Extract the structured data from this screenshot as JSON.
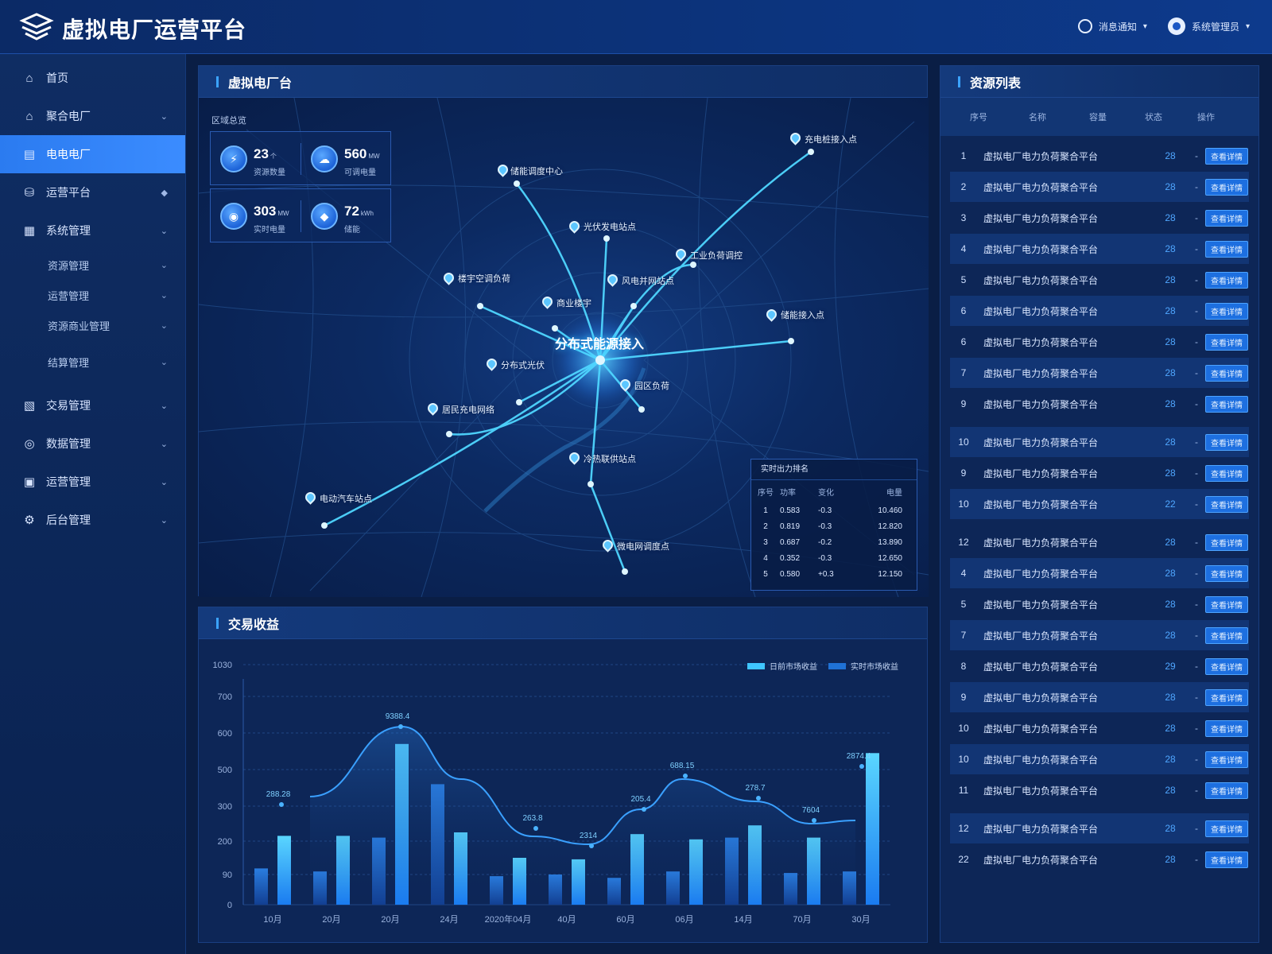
{
  "app": {
    "title": "虚拟电厂运营平台"
  },
  "header": {
    "notice_label": "消息通知",
    "user_label": "系统管理员"
  },
  "sidebar": {
    "items": [
      {
        "label": "首页",
        "icon": "home-icon"
      },
      {
        "label": "聚合电厂",
        "icon": "plant-icon"
      },
      {
        "label": "电电电厂",
        "icon": "document-icon"
      },
      {
        "label": "运营平台",
        "icon": "platform-icon"
      },
      {
        "label": "系统管理",
        "icon": "grid-icon"
      }
    ],
    "subitems": [
      {
        "label": "资源管理"
      },
      {
        "label": "运营管理"
      },
      {
        "label": "资源商业管理"
      },
      {
        "label": "结算管理"
      }
    ],
    "items2": [
      {
        "label": "交易管理",
        "icon": "chart-icon"
      },
      {
        "label": "数据管理",
        "icon": "data-icon"
      },
      {
        "label": "运营管理",
        "icon": "monitor-icon"
      },
      {
        "label": "后台管理",
        "icon": "settings-icon"
      }
    ]
  },
  "map_panel": {
    "title": "虚拟电厂台",
    "subtitle": "区域总览",
    "center_label": "分布式能源接入",
    "stats": [
      {
        "value": "23",
        "unit": "个",
        "label": "资源数量"
      },
      {
        "value": "560",
        "unit": "MW",
        "label": "可调电量"
      },
      {
        "value": "303",
        "unit": "MW",
        "label": "实时电量"
      },
      {
        "value": "72",
        "unit": "kWh",
        "label": "储能"
      }
    ],
    "nodes": [
      {
        "label": "储能调度中心"
      },
      {
        "label": "光伏发电站点"
      },
      {
        "label": "充电桩接入点"
      },
      {
        "label": "工业负荷调控"
      },
      {
        "label": "楼宇空调负荷"
      },
      {
        "label": "风电并网站点"
      },
      {
        "label": "商业楼宇"
      },
      {
        "label": "储能接入点"
      },
      {
        "label": "分布式光伏"
      },
      {
        "label": "园区负荷"
      },
      {
        "label": "居民充电网络"
      },
      {
        "label": "电动汽车站点"
      },
      {
        "label": "冷热联供站点"
      },
      {
        "label": "微电网调度点"
      }
    ],
    "legend": {
      "title": "实时出力排名",
      "headers": [
        "序号",
        "功率",
        "变化",
        "电量"
      ],
      "rows": [
        [
          "1",
          "0.583",
          "-0.3",
          "10.460"
        ],
        [
          "2",
          "0.819",
          "-0.3",
          "12.820"
        ],
        [
          "3",
          "0.687",
          "-0.2",
          "13.890"
        ],
        [
          "4",
          "0.352",
          "-0.3",
          "12.650"
        ],
        [
          "5",
          "0.580",
          "+0.3",
          "12.150"
        ]
      ]
    }
  },
  "chart_data": {
    "type": "bar",
    "title": "交易收益",
    "legend": [
      "日前市场收益",
      "实时市场收益"
    ],
    "y_ticks": [
      "0",
      "90",
      "200",
      "300",
      "500",
      "600",
      "700",
      "1030"
    ],
    "x_labels": [
      "10月",
      "20月",
      "20月",
      "24月",
      "2020年04月",
      "40月",
      "60月",
      "06月",
      "14月",
      "70月",
      "30月"
    ],
    "series": [
      {
        "name": "日前市场收益",
        "values": [
          110,
          100,
          210,
          420,
          85,
          90,
          80,
          100,
          210,
          95,
          100
        ]
      },
      {
        "name": "实时市场收益",
        "values": [
          215,
          215,
          570,
          225,
          145,
          140,
          220,
          205,
          245,
          210,
          545
        ]
      }
    ],
    "line_labels": [
      "288.28",
      "9388.4",
      "263.8",
      "2314",
      "205.4",
      "688.15",
      "278.7",
      "7604",
      "2874.4"
    ],
    "colors": {
      "series1": "#1f72d6",
      "series2": "#3fc6ff",
      "line": "#3aa0ff"
    }
  },
  "res_panel": {
    "title": "资源列表",
    "headers": [
      "序号",
      "名称",
      "容量",
      "状态",
      "操作"
    ],
    "rows": [
      {
        "no": "1",
        "name": "虚拟电厂电力负荷聚合平台",
        "num": "28",
        "dash": "-",
        "op": "查看详情"
      },
      {
        "no": "2",
        "name": "虚拟电厂电力负荷聚合平台",
        "num": "28",
        "dash": "-",
        "op": "查看详情"
      },
      {
        "no": "3",
        "name": "虚拟电厂电力负荷聚合平台",
        "num": "28",
        "dash": "-",
        "op": "查看详情"
      },
      {
        "no": "4",
        "name": "虚拟电厂电力负荷聚合平台",
        "num": "28",
        "dash": "-",
        "op": "查看详情"
      },
      {
        "no": "5",
        "name": "虚拟电厂电力负荷聚合平台",
        "num": "28",
        "dash": "-",
        "op": "查看详情"
      },
      {
        "no": "6",
        "name": "虚拟电厂电力负荷聚合平台",
        "num": "28",
        "dash": "-",
        "op": "查看详情"
      },
      {
        "no": "6",
        "name": "虚拟电厂电力负荷聚合平台",
        "num": "28",
        "dash": "-",
        "op": "查看详情"
      },
      {
        "no": "7",
        "name": "虚拟电厂电力负荷聚合平台",
        "num": "28",
        "dash": "-",
        "op": "查看详情"
      },
      {
        "no": "9",
        "name": "虚拟电厂电力负荷聚合平台",
        "num": "28",
        "dash": "-",
        "op": "查看详情"
      },
      {
        "no": "10",
        "name": "虚拟电厂电力负荷聚合平台",
        "num": "28",
        "dash": "-",
        "op": "查看详情"
      },
      {
        "no": "9",
        "name": "虚拟电厂电力负荷聚合平台",
        "num": "28",
        "dash": "-",
        "op": "查看详情"
      },
      {
        "no": "10",
        "name": "虚拟电厂电力负荷聚合平台",
        "num": "22",
        "dash": "-",
        "op": "查看详情"
      },
      {
        "no": "12",
        "name": "虚拟电厂电力负荷聚合平台",
        "num": "28",
        "dash": "-",
        "op": "查看详情"
      },
      {
        "no": "4",
        "name": "虚拟电厂电力负荷聚合平台",
        "num": "28",
        "dash": "-",
        "op": "查看详情"
      },
      {
        "no": "5",
        "name": "虚拟电厂电力负荷聚合平台",
        "num": "28",
        "dash": "-",
        "op": "查看详情"
      },
      {
        "no": "7",
        "name": "虚拟电厂电力负荷聚合平台",
        "num": "28",
        "dash": "-",
        "op": "查看详情"
      },
      {
        "no": "8",
        "name": "虚拟电厂电力负荷聚合平台",
        "num": "29",
        "dash": "-",
        "op": "查看详情"
      },
      {
        "no": "9",
        "name": "虚拟电厂电力负荷聚合平台",
        "num": "28",
        "dash": "-",
        "op": "查看详情"
      },
      {
        "no": "10",
        "name": "虚拟电厂电力负荷聚合平台",
        "num": "28",
        "dash": "-",
        "op": "查看详情"
      },
      {
        "no": "10",
        "name": "虚拟电厂电力负荷聚合平台",
        "num": "28",
        "dash": "-",
        "op": "查看详情"
      },
      {
        "no": "11",
        "name": "虚拟电厂电力负荷聚合平台",
        "num": "28",
        "dash": "-",
        "op": "查看详情"
      },
      {
        "no": "12",
        "name": "虚拟电厂电力负荷聚合平台",
        "num": "28",
        "dash": "-",
        "op": "查看详情"
      },
      {
        "no": "22",
        "name": "虚拟电厂电力负荷聚合平台",
        "num": "28",
        "dash": "-",
        "op": "查看详情"
      }
    ]
  }
}
